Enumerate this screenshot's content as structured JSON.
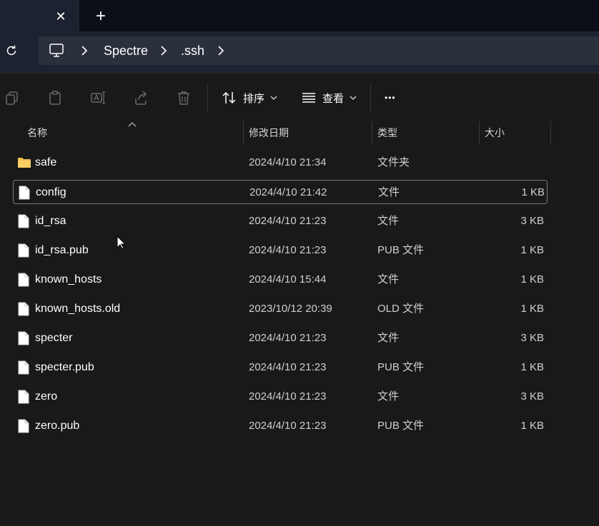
{
  "tab": {
    "close_glyph": "✕",
    "new_glyph": "+"
  },
  "address": {
    "breadcrumbs": [
      "Spectre",
      ".ssh"
    ]
  },
  "toolbar": {
    "sort_label": "排序",
    "view_label": "查看",
    "more_glyph": "•••"
  },
  "columns": {
    "name": "名称",
    "date": "修改日期",
    "type": "类型",
    "size": "大小"
  },
  "files": [
    {
      "name": "safe",
      "date": "2024/4/10 21:34",
      "type": "文件夹",
      "size": "",
      "icon": "folder-icon"
    },
    {
      "name": "config",
      "date": "2024/4/10 21:42",
      "type": "文件",
      "size": "1 KB",
      "icon": "file-icon"
    },
    {
      "name": "id_rsa",
      "date": "2024/4/10 21:23",
      "type": "文件",
      "size": "3 KB",
      "icon": "file-icon"
    },
    {
      "name": "id_rsa.pub",
      "date": "2024/4/10 21:23",
      "type": "PUB 文件",
      "size": "1 KB",
      "icon": "file-icon"
    },
    {
      "name": "known_hosts",
      "date": "2024/4/10 15:44",
      "type": "文件",
      "size": "1 KB",
      "icon": "file-icon"
    },
    {
      "name": "known_hosts.old",
      "date": "2023/10/12 20:39",
      "type": "OLD 文件",
      "size": "1 KB",
      "icon": "file-icon"
    },
    {
      "name": "specter",
      "date": "2024/4/10 21:23",
      "type": "文件",
      "size": "3 KB",
      "icon": "file-icon"
    },
    {
      "name": "specter.pub",
      "date": "2024/4/10 21:23",
      "type": "PUB 文件",
      "size": "1 KB",
      "icon": "file-icon"
    },
    {
      "name": "zero",
      "date": "2024/4/10 21:23",
      "type": "文件",
      "size": "3 KB",
      "icon": "file-icon"
    },
    {
      "name": "zero.pub",
      "date": "2024/4/10 21:23",
      "type": "PUB 文件",
      "size": "1 KB",
      "icon": "file-icon"
    }
  ],
  "selected_file": "config",
  "colors": {
    "accent_folder": "#f2c14e",
    "selected_border": "#7a7a7a",
    "background": "#191919"
  }
}
